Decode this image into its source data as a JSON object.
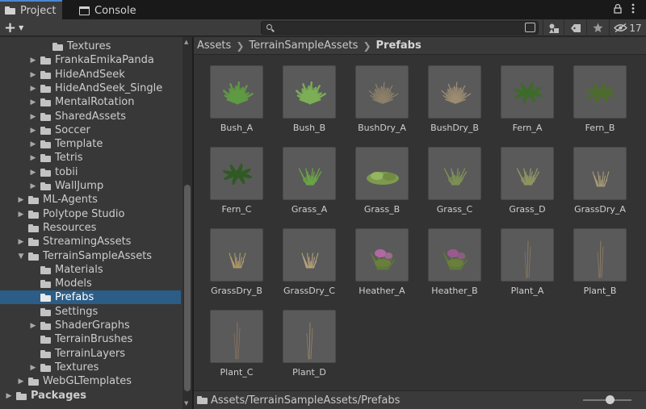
{
  "tabs": [
    {
      "label": "Project",
      "icon": "folder-icon",
      "active": true
    },
    {
      "label": "Console",
      "icon": "console-icon",
      "active": false
    }
  ],
  "tab_menu": {
    "lock_icon": "lock-icon",
    "more_icon": "kebab-menu-icon"
  },
  "toolbar": {
    "add_label": "+",
    "search_value": "",
    "search_placeholder": "",
    "hidden_packages_count": "17"
  },
  "tree": [
    {
      "label": "Textures",
      "depth": 3,
      "arrow": false,
      "selected": false
    },
    {
      "label": "FrankaEmikaPanda",
      "depth": 2,
      "arrow": true,
      "selected": false
    },
    {
      "label": "HideAndSeek",
      "depth": 2,
      "arrow": true,
      "selected": false
    },
    {
      "label": "HideAndSeek_Single",
      "depth": 2,
      "arrow": true,
      "selected": false
    },
    {
      "label": "MentalRotation",
      "depth": 2,
      "arrow": true,
      "selected": false
    },
    {
      "label": "SharedAssets",
      "depth": 2,
      "arrow": true,
      "selected": false
    },
    {
      "label": "Soccer",
      "depth": 2,
      "arrow": true,
      "selected": false
    },
    {
      "label": "Template",
      "depth": 2,
      "arrow": true,
      "selected": false
    },
    {
      "label": "Tetris",
      "depth": 2,
      "arrow": true,
      "selected": false
    },
    {
      "label": "tobii",
      "depth": 2,
      "arrow": true,
      "selected": false
    },
    {
      "label": "WallJump",
      "depth": 2,
      "arrow": true,
      "selected": false
    },
    {
      "label": "ML-Agents",
      "depth": 1,
      "arrow": true,
      "selected": false
    },
    {
      "label": "Polytope Studio",
      "depth": 1,
      "arrow": true,
      "selected": false
    },
    {
      "label": "Resources",
      "depth": 1,
      "arrow": false,
      "selected": false
    },
    {
      "label": "StreamingAssets",
      "depth": 1,
      "arrow": true,
      "selected": false
    },
    {
      "label": "TerrainSampleAssets",
      "depth": 1,
      "arrow": "open",
      "selected": false
    },
    {
      "label": "Materials",
      "depth": 2,
      "arrow": false,
      "selected": false
    },
    {
      "label": "Models",
      "depth": 2,
      "arrow": false,
      "selected": false
    },
    {
      "label": "Prefabs",
      "depth": 2,
      "arrow": false,
      "selected": true
    },
    {
      "label": "Settings",
      "depth": 2,
      "arrow": false,
      "selected": false
    },
    {
      "label": "ShaderGraphs",
      "depth": 2,
      "arrow": true,
      "selected": false
    },
    {
      "label": "TerrainBrushes",
      "depth": 2,
      "arrow": false,
      "selected": false
    },
    {
      "label": "TerrainLayers",
      "depth": 2,
      "arrow": false,
      "selected": false
    },
    {
      "label": "Textures",
      "depth": 2,
      "arrow": true,
      "selected": false
    },
    {
      "label": "WebGLTemplates",
      "depth": 1,
      "arrow": true,
      "selected": false
    },
    {
      "label": "Packages",
      "depth": 0,
      "arrow": true,
      "selected": false,
      "bold": true
    }
  ],
  "breadcrumb": {
    "items": [
      "Assets",
      "TerrainSampleAssets"
    ],
    "current": "Prefabs"
  },
  "assets": [
    {
      "name": "Bush_A",
      "kind": "bush",
      "color": "#5f9a44"
    },
    {
      "name": "Bush_B",
      "kind": "bush",
      "color": "#7cae55"
    },
    {
      "name": "BushDry_A",
      "kind": "drybush",
      "color": "#8c8068"
    },
    {
      "name": "BushDry_B",
      "kind": "drybush",
      "color": "#9c8c72"
    },
    {
      "name": "Fern_A",
      "kind": "fern",
      "color": "#3d6b2a"
    },
    {
      "name": "Fern_B",
      "kind": "fern",
      "color": "#4d6b2c"
    },
    {
      "name": "Fern_C",
      "kind": "fern",
      "color": "#2f5a22"
    },
    {
      "name": "Grass_A",
      "kind": "grass",
      "color": "#6aa444"
    },
    {
      "name": "Grass_B",
      "kind": "grassmat",
      "color": "#7d9a4e"
    },
    {
      "name": "Grass_C",
      "kind": "grass",
      "color": "#7e8f55"
    },
    {
      "name": "Grass_D",
      "kind": "grass",
      "color": "#8f9460"
    },
    {
      "name": "GrassDry_A",
      "kind": "dry",
      "color": "#a89a78"
    },
    {
      "name": "GrassDry_B",
      "kind": "dry",
      "color": "#b09a6a"
    },
    {
      "name": "GrassDry_C",
      "kind": "dry",
      "color": "#b8a27a"
    },
    {
      "name": "Heather_A",
      "kind": "heather",
      "color": "#b06aa2"
    },
    {
      "name": "Heather_B",
      "kind": "heather",
      "color": "#9a5a8e"
    },
    {
      "name": "Plant_A",
      "kind": "plant",
      "color": "#8a7a62"
    },
    {
      "name": "Plant_B",
      "kind": "plant",
      "color": "#8f7f66"
    },
    {
      "name": "Plant_C",
      "kind": "plant",
      "color": "#8a7560"
    },
    {
      "name": "Plant_D",
      "kind": "plant",
      "color": "#9a8462"
    }
  ],
  "footer": {
    "path": "Assets/TerrainSampleAssets/Prefabs",
    "zoom_fraction": 0.55
  },
  "colors": {
    "selection": "#2c5d87",
    "accent": "#4a87d6"
  }
}
